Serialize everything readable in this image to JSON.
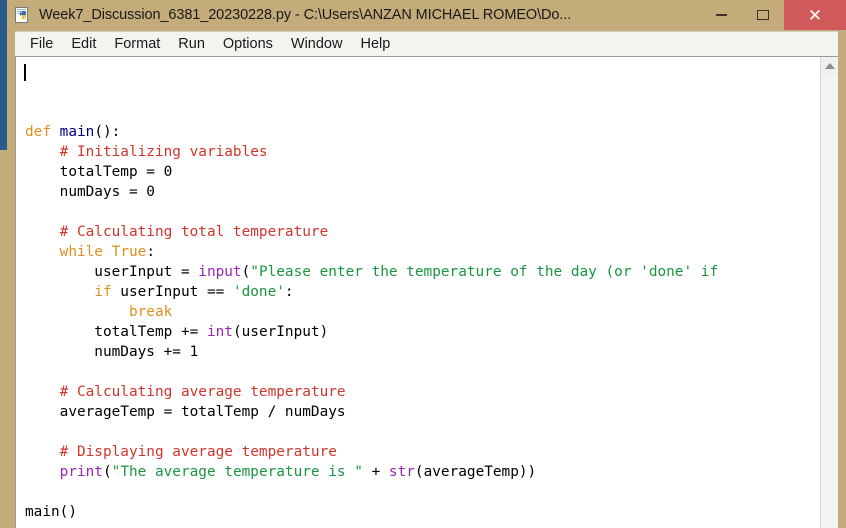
{
  "window": {
    "title": "Week7_Discussion_6381_20230228.py - C:\\Users\\ANZAN MICHAEL ROMEO\\Do...",
    "icon": "python-file-icon",
    "controls": {
      "minimize": "–",
      "maximize": "□",
      "close": "✕"
    },
    "titlebar_color": "#c3ab7a",
    "close_button_color": "#d05a5a"
  },
  "menubar": {
    "items": [
      {
        "label": "File"
      },
      {
        "label": "Edit"
      },
      {
        "label": "Format"
      },
      {
        "label": "Run"
      },
      {
        "label": "Options"
      },
      {
        "label": "Window"
      },
      {
        "label": "Help"
      }
    ]
  },
  "editor": {
    "language": "python",
    "caret_line": 1,
    "caret_column": 1,
    "syntax_colors": {
      "keyword": "#e08f1f",
      "builtin": "#9a26b5",
      "string": "#1a9641",
      "comment": "#d1352b",
      "definition": "#00007f",
      "plain": "#000000",
      "background": "#ffffff"
    },
    "lines": [
      {
        "tokens": [
          {
            "t": "def",
            "c": "kw"
          },
          {
            "t": " ",
            "c": "plain"
          },
          {
            "t": "main",
            "c": "def"
          },
          {
            "t": "():",
            "c": "plain"
          }
        ]
      },
      {
        "tokens": [
          {
            "t": "    # Initializing variables",
            "c": "cmt"
          }
        ]
      },
      {
        "tokens": [
          {
            "t": "    totalTemp = 0",
            "c": "plain"
          }
        ]
      },
      {
        "tokens": [
          {
            "t": "    numDays = 0",
            "c": "plain"
          }
        ]
      },
      {
        "tokens": [
          {
            "t": "",
            "c": "plain"
          }
        ]
      },
      {
        "tokens": [
          {
            "t": "    # Calculating total temperature",
            "c": "cmt"
          }
        ]
      },
      {
        "tokens": [
          {
            "t": "    ",
            "c": "plain"
          },
          {
            "t": "while",
            "c": "kw"
          },
          {
            "t": " ",
            "c": "plain"
          },
          {
            "t": "True",
            "c": "kw"
          },
          {
            "t": ":",
            "c": "plain"
          }
        ]
      },
      {
        "tokens": [
          {
            "t": "        userInput = ",
            "c": "plain"
          },
          {
            "t": "input",
            "c": "builtin"
          },
          {
            "t": "(",
            "c": "plain"
          },
          {
            "t": "\"Please enter the temperature of the day (or 'done' if",
            "c": "str"
          }
        ]
      },
      {
        "tokens": [
          {
            "t": "        ",
            "c": "plain"
          },
          {
            "t": "if",
            "c": "kw"
          },
          {
            "t": " userInput == ",
            "c": "plain"
          },
          {
            "t": "'done'",
            "c": "str"
          },
          {
            "t": ":",
            "c": "plain"
          }
        ]
      },
      {
        "tokens": [
          {
            "t": "            ",
            "c": "plain"
          },
          {
            "t": "break",
            "c": "kw"
          }
        ]
      },
      {
        "tokens": [
          {
            "t": "        totalTemp += ",
            "c": "plain"
          },
          {
            "t": "int",
            "c": "builtin"
          },
          {
            "t": "(userInput)",
            "c": "plain"
          }
        ]
      },
      {
        "tokens": [
          {
            "t": "        numDays += 1",
            "c": "plain"
          }
        ]
      },
      {
        "tokens": [
          {
            "t": "",
            "c": "plain"
          }
        ]
      },
      {
        "tokens": [
          {
            "t": "    # Calculating average temperature",
            "c": "cmt"
          }
        ]
      },
      {
        "tokens": [
          {
            "t": "    averageTemp = totalTemp / numDays",
            "c": "plain"
          }
        ]
      },
      {
        "tokens": [
          {
            "t": "",
            "c": "plain"
          }
        ]
      },
      {
        "tokens": [
          {
            "t": "    # Displaying average temperature",
            "c": "cmt"
          }
        ]
      },
      {
        "tokens": [
          {
            "t": "    ",
            "c": "plain"
          },
          {
            "t": "print",
            "c": "builtin"
          },
          {
            "t": "(",
            "c": "plain"
          },
          {
            "t": "\"The average temperature is \"",
            "c": "str"
          },
          {
            "t": " + ",
            "c": "plain"
          },
          {
            "t": "str",
            "c": "builtin"
          },
          {
            "t": "(averageTemp))",
            "c": "plain"
          }
        ]
      },
      {
        "tokens": [
          {
            "t": "",
            "c": "plain"
          }
        ]
      },
      {
        "tokens": [
          {
            "t": "main()",
            "c": "plain"
          }
        ]
      }
    ]
  },
  "scrollbar": {
    "up_arrow": "chevron-up",
    "orientation": "vertical"
  }
}
